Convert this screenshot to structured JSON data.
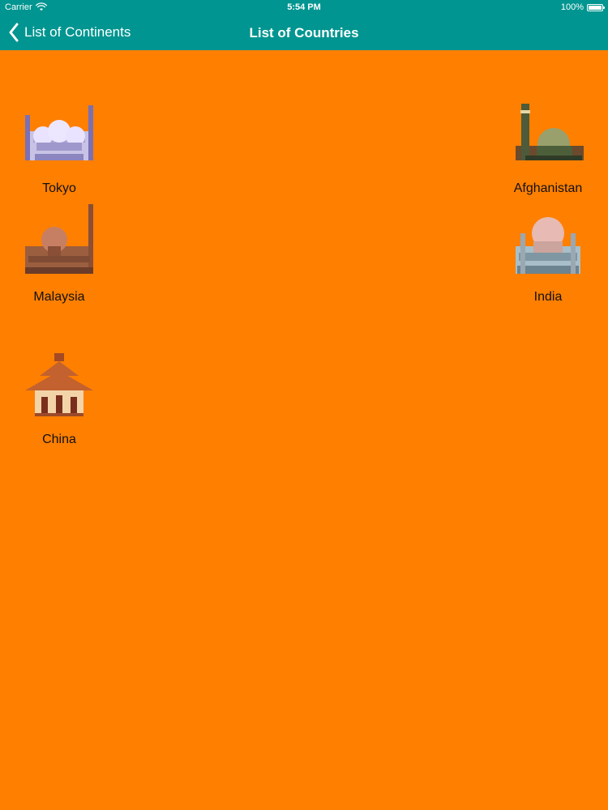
{
  "status": {
    "carrier": "Carrier",
    "time": "5:54 PM",
    "battery": "100%"
  },
  "nav": {
    "back_label": "List of Continents",
    "title": "List of Countries"
  },
  "items": [
    {
      "label": "Tokyo",
      "icon": "mosque-icon"
    },
    {
      "label": "Afghanistan",
      "icon": "mosque-icon"
    },
    {
      "label": "Malaysia",
      "icon": "mosque-icon"
    },
    {
      "label": "India",
      "icon": "mosque-icon"
    },
    {
      "label": "China",
      "icon": "pagoda-icon"
    }
  ],
  "colors": {
    "background": "#ff7f00",
    "navbar": "#009590"
  }
}
